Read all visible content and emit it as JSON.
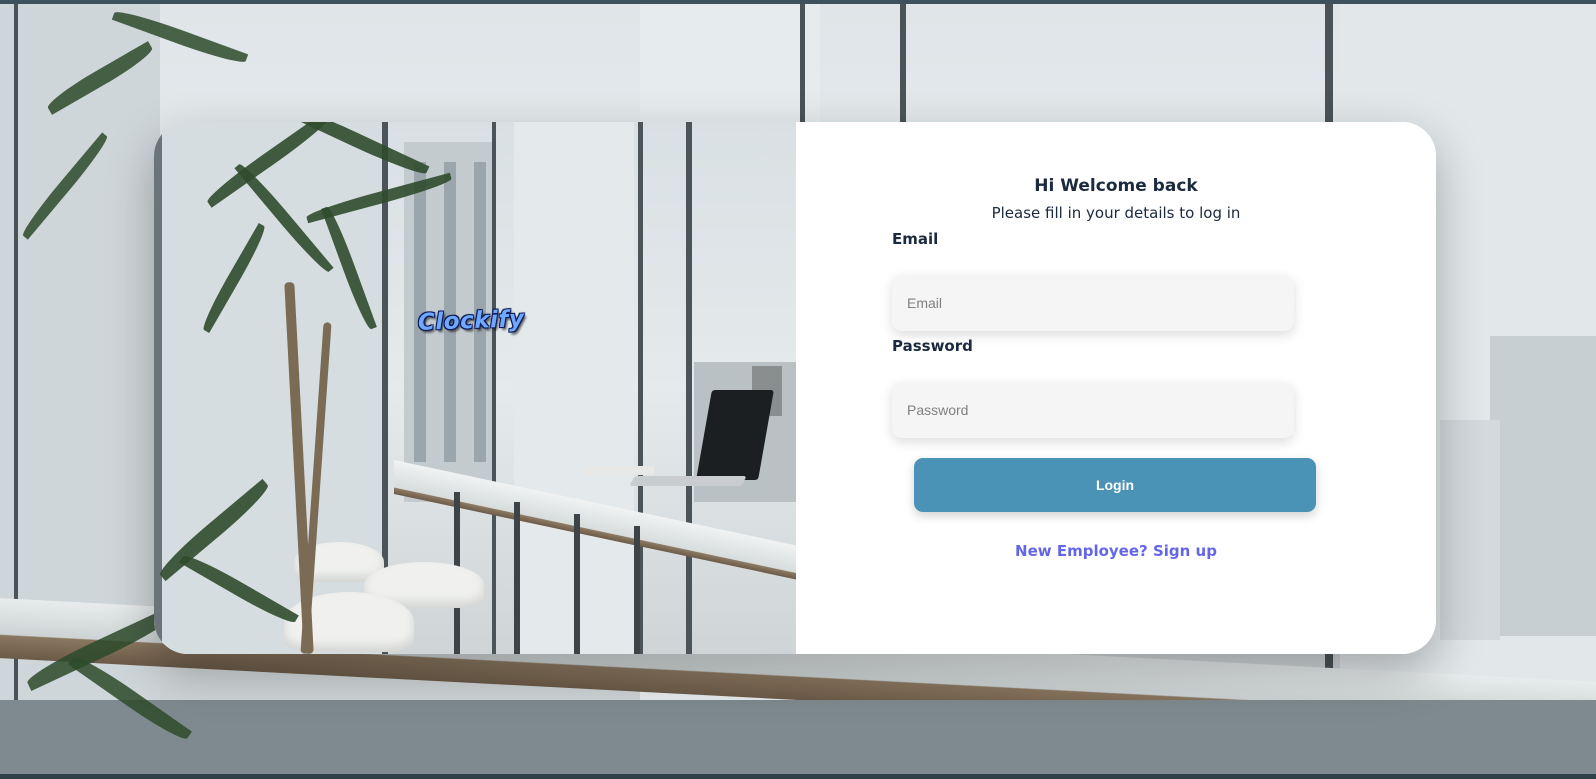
{
  "brand": {
    "logo_text": "Clockify"
  },
  "login_form": {
    "heading": "Hi Welcome back",
    "subheading": "Please fill in your details to log in",
    "email": {
      "label": "Email",
      "placeholder": "Email",
      "value": ""
    },
    "password": {
      "label": "Password",
      "placeholder": "Password",
      "value": ""
    },
    "login_button": "Login",
    "signup_link": "New Employee? Sign up"
  },
  "colors": {
    "accent_button": "#4a93b6",
    "link": "#6466e9",
    "heading_text": "#1b2a3e",
    "input_bg": "#f5f5f5",
    "card_bg": "#ffffff"
  }
}
